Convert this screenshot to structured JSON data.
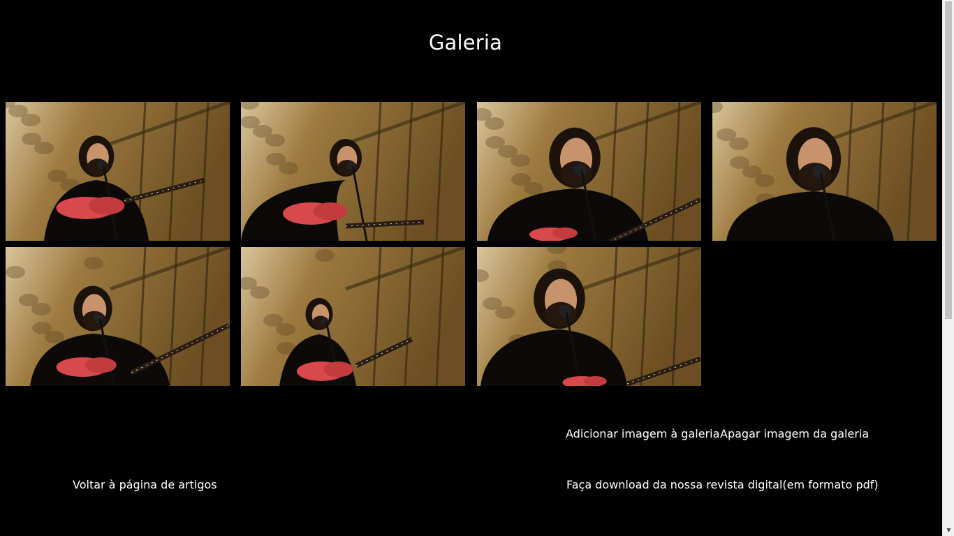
{
  "page": {
    "title": "Galeria"
  },
  "gallery": {
    "photos": [
      {
        "alt": "guitarist-photo-1",
        "pose": "guitar-left"
      },
      {
        "alt": "guitarist-photo-2",
        "pose": "guitar-low"
      },
      {
        "alt": "guitarist-photo-3",
        "pose": "close-up-mic"
      },
      {
        "alt": "guitarist-photo-4",
        "pose": "close-up-face"
      },
      {
        "alt": "guitarist-photo-5",
        "pose": "guitar-right"
      },
      {
        "alt": "guitarist-photo-6",
        "pose": "wide-guitar"
      },
      {
        "alt": "guitarist-photo-7",
        "pose": "close-up-eyes-closed"
      }
    ]
  },
  "actions": {
    "add_image": "Adicionar imagem à galeria",
    "delete_image": "Apagar imagem da galeria",
    "back_to_articles": "Voltar à página de artigos",
    "download_magazine": "Faça download da nossa revista digital(em formato pdf)"
  },
  "colors": {
    "background": "#000000",
    "text": "#ffffff",
    "wall": "#8a6a35",
    "guitar": "#d9484a"
  }
}
